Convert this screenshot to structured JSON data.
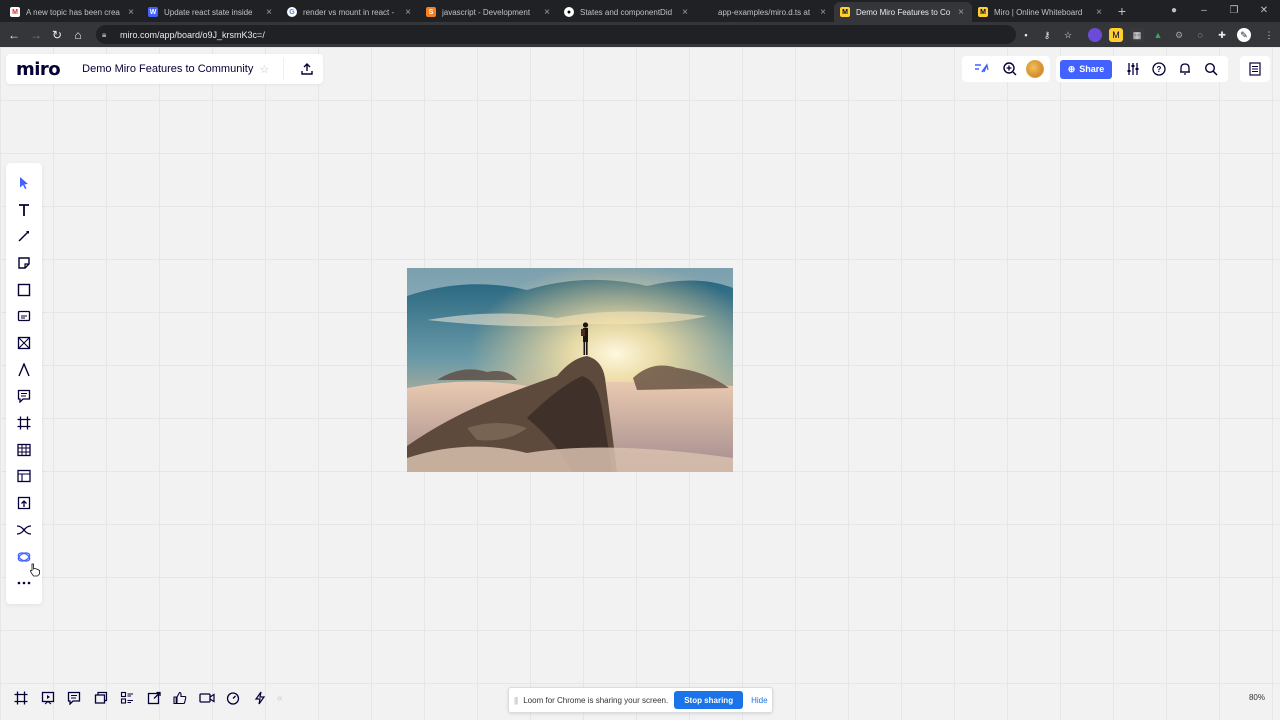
{
  "browser": {
    "tabs": [
      {
        "title": "A new topic has been crea",
        "favicon": "gmail-icon",
        "color": "#d93025",
        "active": false
      },
      {
        "title": "Update react state inside",
        "favicon": "miro-w-icon",
        "color": "#4262ff",
        "active": false
      },
      {
        "title": "render vs mount in react -",
        "favicon": "google-icon",
        "color": "#ffffff",
        "active": false
      },
      {
        "title": "javascript - Development",
        "favicon": "stackoverflow-icon",
        "color": "#f48024",
        "active": false
      },
      {
        "title": "States and componentDid",
        "favicon": "medium-icon",
        "color": "#ffffff",
        "active": false
      },
      {
        "title": "app-examples/miro.d.ts at",
        "favicon": "github-icon",
        "color": "#202124",
        "active": false
      },
      {
        "title": "Demo Miro Features to Co",
        "favicon": "miro-icon",
        "color": "#ffd02f",
        "active": true
      },
      {
        "title": "Miro | Online Whiteboard",
        "favicon": "miro-icon",
        "color": "#ffd02f",
        "active": false
      }
    ],
    "url": "miro.com/app/board/o9J_krsmK3c=/"
  },
  "board": {
    "logo": "miro",
    "title": "Demo Miro Features to Community",
    "share_label": "Share",
    "zoom": "80%",
    "accent": "#4262ff"
  },
  "loom": {
    "message": "Loom for Chrome is sharing your screen.",
    "stop_label": "Stop sharing",
    "hide_label": "Hide"
  }
}
